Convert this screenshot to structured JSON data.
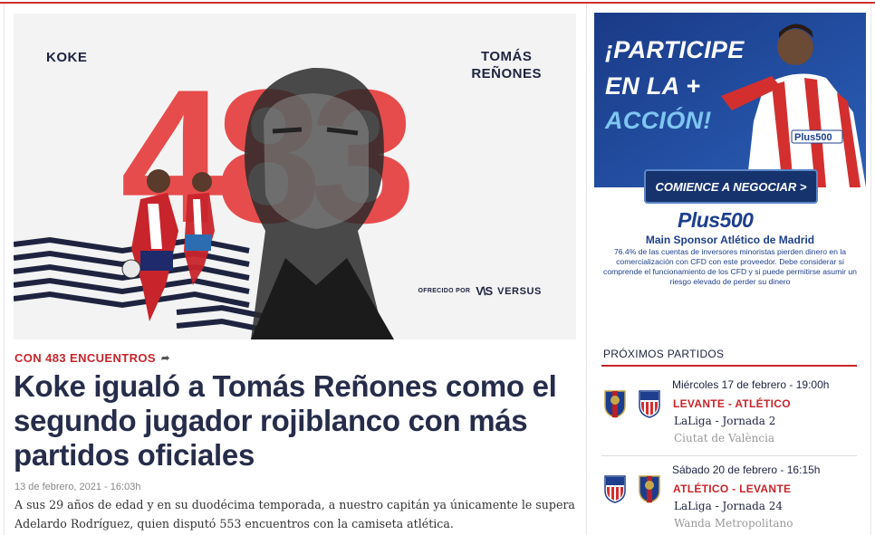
{
  "hero": {
    "name_left": "KOKE",
    "name_right": "TOMÁS\nREÑONES",
    "big_number": "483",
    "sponsor_prefix": "OFRECIDO POR",
    "sponsor_mark": "V\\S",
    "sponsor_name": "VERSUS"
  },
  "article": {
    "kicker": "CON 483 ENCUENTROS",
    "headline": "Koke igualó a Tomás Reñones como el segundo jugador rojiblanco con más partidos oficiales",
    "date": "13 de febrero, 2021 - 16:03h",
    "summary": "A sus 29 años de edad y en su duodécima temporada, a nuestro capitán ya únicamente le supera Adelardo Rodríguez, quien disputó 553 encuentros con la camiseta atlética."
  },
  "ad": {
    "line1": "¡PARTICIPE",
    "line2": "EN LA +",
    "line3": "ACCIÓN!",
    "cta": "COMIENCE A NEGOCIAR >",
    "logo": "Plus500",
    "shirt_logo": "Plus500",
    "sponsor_line": "Main Sponsor Atlético de Madrid",
    "disclaimer": "76.4% de las cuentas de inversores minoristas pierden dinero en la comercialización con CFD con este proveedor. Debe considerar si comprende el funcionamiento de los CFD y si puede permitirse asumir un riesgo elevado de perder su dinero"
  },
  "matches": {
    "title": "PRÓXIMOS PARTIDOS",
    "items": [
      {
        "date": "Miércoles 17 de febrero - 19:00h",
        "teams": "LEVANTE - ATLÉTICO",
        "competition": "LaLiga - Jornada 2",
        "venue": "Ciutat de València",
        "home_crest": "levante-crest-icon",
        "away_crest": "atletico-crest-icon"
      },
      {
        "date": "Sábado 20 de febrero - 16:15h",
        "teams": "ATLÉTICO - LEVANTE",
        "competition": "LaLiga - Jornada 24",
        "venue": "Wanda Metropolitano",
        "home_crest": "atletico-crest-icon",
        "away_crest": "levante-crest-icon"
      }
    ]
  },
  "colors": {
    "brand_red": "#c8242b",
    "navy": "#262d4a",
    "ad_blue": "#1e3f8d"
  }
}
